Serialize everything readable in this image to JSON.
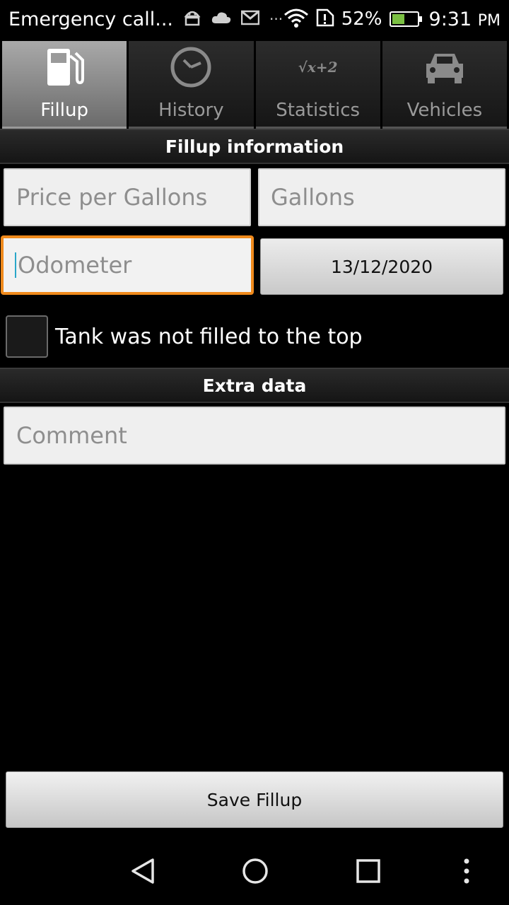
{
  "status_bar": {
    "title": "Emergency call...",
    "battery_percent": "52%",
    "battery_level": 0.52,
    "time": "9:31",
    "ampm": "PM",
    "more": "···"
  },
  "tabs": [
    {
      "label": "Fillup",
      "icon": "fuel-pump-icon",
      "active": true
    },
    {
      "label": "History",
      "icon": "clock-icon",
      "active": false
    },
    {
      "label": "Statistics",
      "icon": "formula-icon",
      "active": false
    },
    {
      "label": "Vehicles",
      "icon": "car-icon",
      "active": false
    }
  ],
  "formula_text": "√x+2",
  "fillup_section": {
    "title": "Fillup information",
    "price_placeholder": "Price per Gallons",
    "gallons_placeholder": "Gallons",
    "odometer_placeholder": "Odometer",
    "date": "13/12/2020",
    "tank_checkbox_label": "Tank was not filled to the top",
    "tank_checked": false
  },
  "extra_section": {
    "title": "Extra data",
    "comment_placeholder": "Comment"
  },
  "save_button": "Save Fillup",
  "colors": {
    "focus_border": "#f08a1c",
    "battery_fill": "#7bc043"
  }
}
